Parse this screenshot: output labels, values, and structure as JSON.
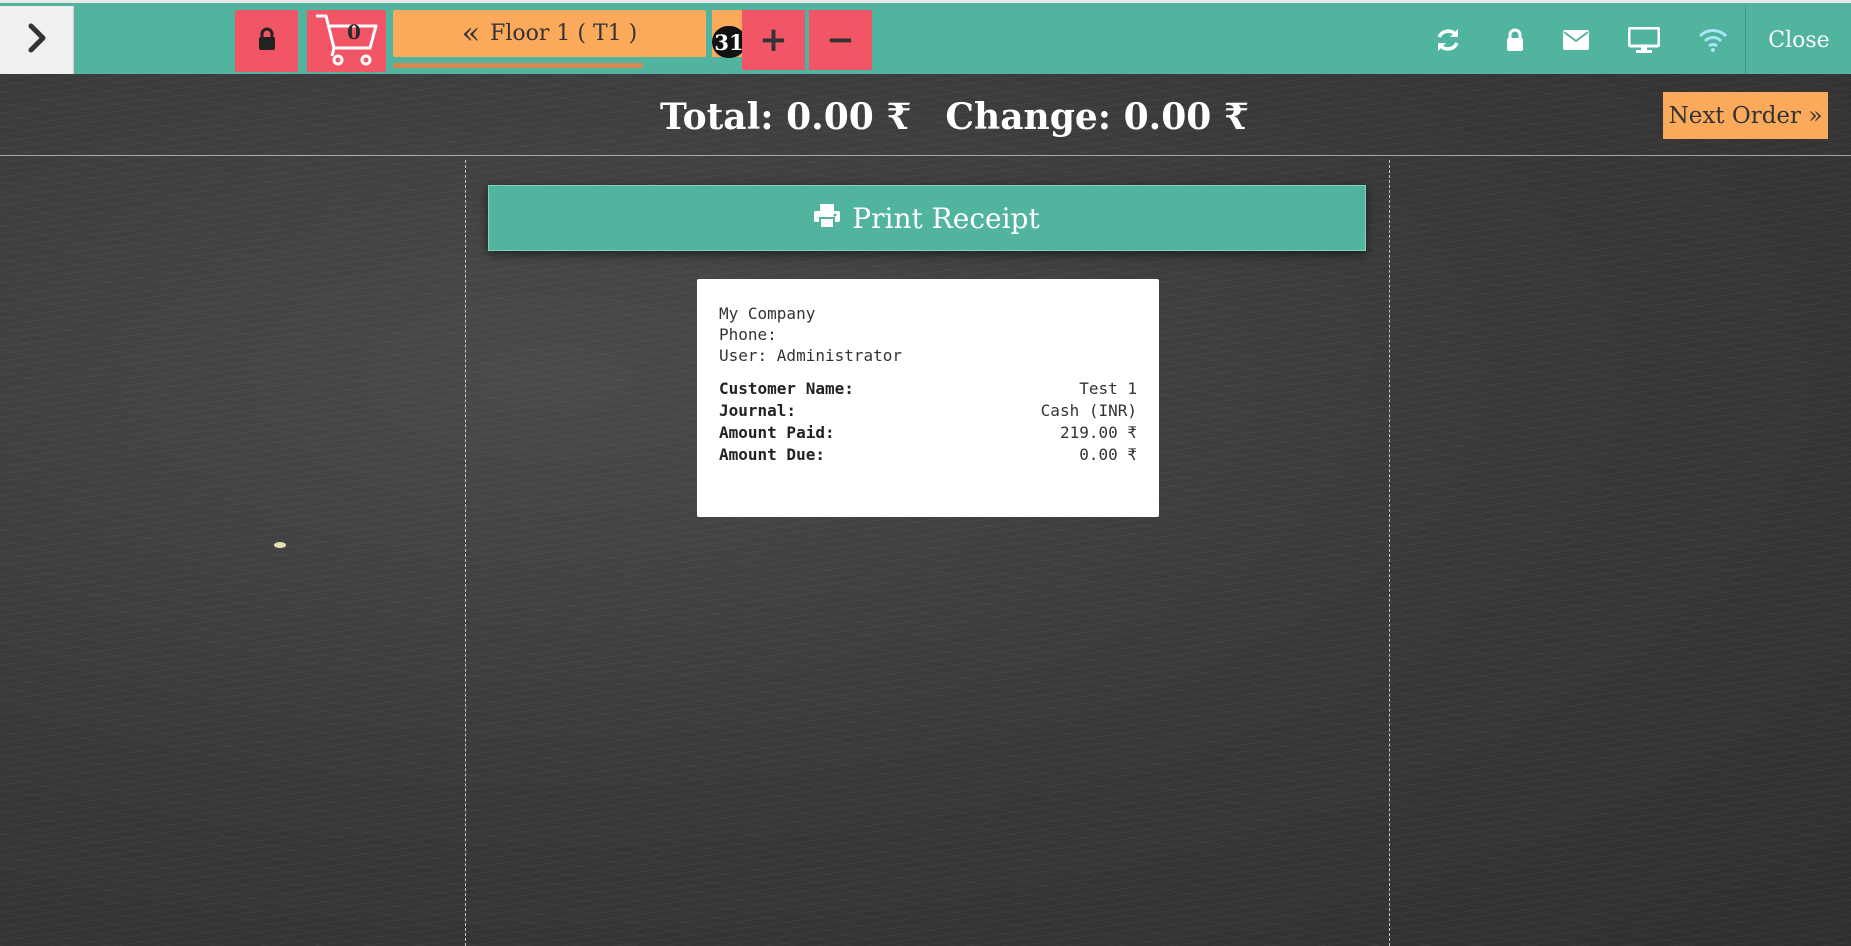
{
  "topbar": {
    "cart_count": "0",
    "floor_label": "Floor 1 ( T1 )",
    "order_badge": "31",
    "plus_label": "+",
    "minus_label": "−",
    "close_label": "Close",
    "icons": [
      "refresh-icon",
      "lock-icon",
      "envelope-icon",
      "monitor-icon",
      "wifi-icon"
    ]
  },
  "totals": {
    "total_text": "Total: 0.00 ₹",
    "change_text": "Change: 0.00 ₹"
  },
  "next_order": {
    "label": "Next Order »"
  },
  "print_button": {
    "label": "Print Receipt"
  },
  "receipt": {
    "company": "My Company",
    "phone": "Phone:",
    "user": "User: Administrator",
    "rows": [
      {
        "key": "Customer Name:",
        "value": "Test 1"
      },
      {
        "key": "Journal:",
        "value": "Cash (INR)"
      },
      {
        "key": "Amount Paid:",
        "value": "219.00 ₹"
      },
      {
        "key": "Amount Due:",
        "value": "0.00 ₹"
      }
    ]
  },
  "colors": {
    "topbar": "#51b49f",
    "red_button": "#f15566",
    "orange_button": "#fbaa5c",
    "badge": "#111111"
  }
}
